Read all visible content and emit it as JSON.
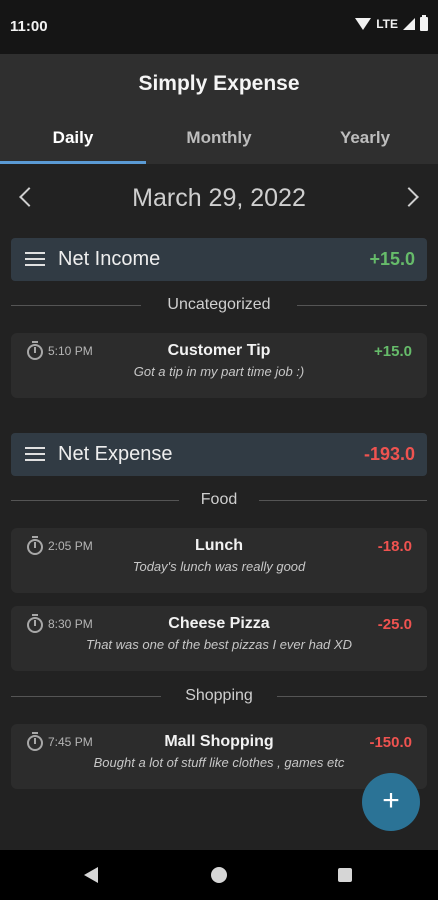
{
  "status_bar": {
    "time": "11:00",
    "network": "LTE"
  },
  "header": {
    "title": "Simply Expense"
  },
  "tabs": [
    {
      "label": "Daily",
      "active": true
    },
    {
      "label": "Monthly",
      "active": false
    },
    {
      "label": "Yearly",
      "active": false
    }
  ],
  "date_nav": {
    "date": "March 29, 2022"
  },
  "income": {
    "title": "Net Income",
    "amount": "+15.0",
    "categories": [
      {
        "name": "Uncategorized",
        "items": [
          {
            "time": "5:10 PM",
            "title": "Customer Tip",
            "description": "Got a tip in my part time job :)",
            "amount": "+15.0"
          }
        ]
      }
    ]
  },
  "expense": {
    "title": "Net Expense",
    "amount": "-193.0",
    "categories": [
      {
        "name": "Food",
        "items": [
          {
            "time": "2:05 PM",
            "title": "Lunch",
            "description": "Today's lunch was really good",
            "amount": "-18.0"
          },
          {
            "time": "8:30 PM",
            "title": "Cheese Pizza",
            "description": "That was one of the best pizzas I ever had XD",
            "amount": "-25.0"
          }
        ]
      },
      {
        "name": "Shopping",
        "items": [
          {
            "time": "7:45 PM",
            "title": "Mall Shopping",
            "description": "Bought a lot of stuff like clothes , games etc",
            "amount": "-150.0"
          }
        ]
      }
    ]
  },
  "fab": {
    "label": "+"
  },
  "colors": {
    "positive": "#66bb6a",
    "negative": "#ef5350",
    "accent": "#5b9bd5",
    "fab": "#2b7396"
  }
}
